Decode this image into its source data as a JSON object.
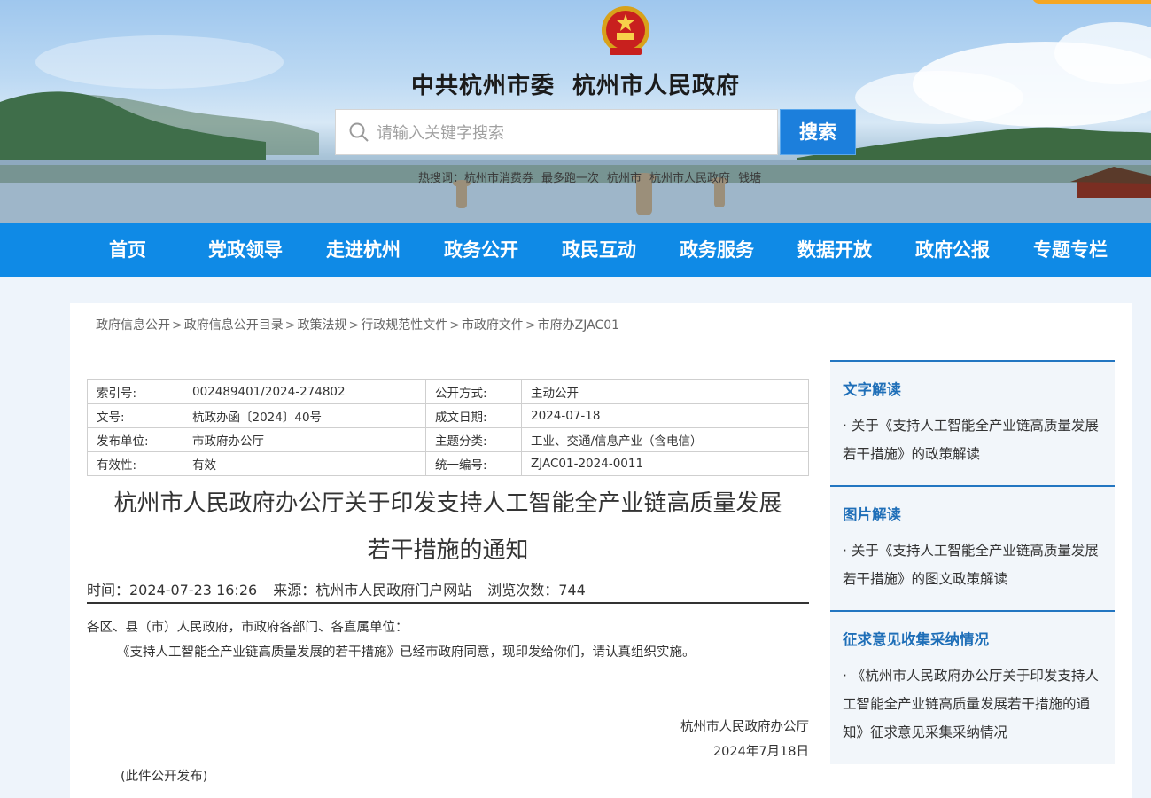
{
  "header": {
    "emblem_icon": "national-emblem-icon",
    "title_parts": [
      "中共杭州市委",
      "杭州市人民政府"
    ],
    "search": {
      "placeholder": "请输入关键字搜索",
      "button_label": "搜索",
      "icon": "search-icon"
    },
    "hot_search": [
      "热搜词：杭州市消费券",
      "最多跑一次",
      "杭州市",
      "杭州市人民政府",
      "钱塘"
    ]
  },
  "nav": {
    "items": [
      "首页",
      "党政领导",
      "走进杭州",
      "政务公开",
      "政民互动",
      "政务服务",
      "数据开放",
      "政府公报",
      "专题专栏"
    ]
  },
  "breadcrumb": [
    "政府信息公开",
    "政府信息公开目录",
    "政策法规",
    "行政规范性文件",
    "市政府文件",
    "市府办ZJAC01"
  ],
  "meta": {
    "rows": [
      {
        "k1": "索引号:",
        "v1": "002489401/2024-274802",
        "k2": "公开方式:",
        "v2": "主动公开"
      },
      {
        "k1": "文号:",
        "v1": "杭政办函〔2024〕40号",
        "k2": "成文日期:",
        "v2": "2024-07-18"
      },
      {
        "k1": "发布单位:",
        "v1": "市政府办公厅",
        "k2": "主题分类:",
        "v2": "工业、交通/信息产业（含电信）"
      },
      {
        "k1": "有效性:",
        "v1": "有效",
        "k2": "统一编号:",
        "v2": "ZJAC01-2024-0011"
      }
    ]
  },
  "document": {
    "title_line1": "杭州市人民政府办公厅关于印发支持人工智能全产业链高质量发展",
    "title_line2": "若干措施的通知",
    "time": "时间：2024-07-23 16:26",
    "source": "来源：杭州市人民政府门户网站",
    "views": "浏览次数：744",
    "salutation": "各区、县（市）人民政府，市政府各部门、各直属单位：",
    "body": "《支持人工智能全产业链高质量发展的若干措施》已经市政府同意，现印发给你们，请认真组织实施。",
    "signer": "杭州市人民政府办公厅",
    "sign_date": "2024年7月18日",
    "public_note": "(此件公开发布)"
  },
  "sidebar": {
    "blocks": [
      {
        "title": "文字解读",
        "text": "·  关于《支持人工智能全产业链高质量发展若干措施》的政策解读"
      },
      {
        "title": "图片解读",
        "text": "·  关于《支持人工智能全产业链高质量发展若干措施》的图文政策解读"
      },
      {
        "title": "征求意见收集采纳情况",
        "text": "·  《杭州市人民政府办公厅关于印发支持人工智能全产业链高质量发展若干措施的通知》征求意见采集采纳情况"
      }
    ]
  },
  "colors": {
    "nav_bg": "#0f8ae6",
    "search_button": "#1c7fdc",
    "sidebar_title": "#1f6fb8",
    "panel_bg": "#ffffff",
    "page_bg": "#eef4fb"
  }
}
